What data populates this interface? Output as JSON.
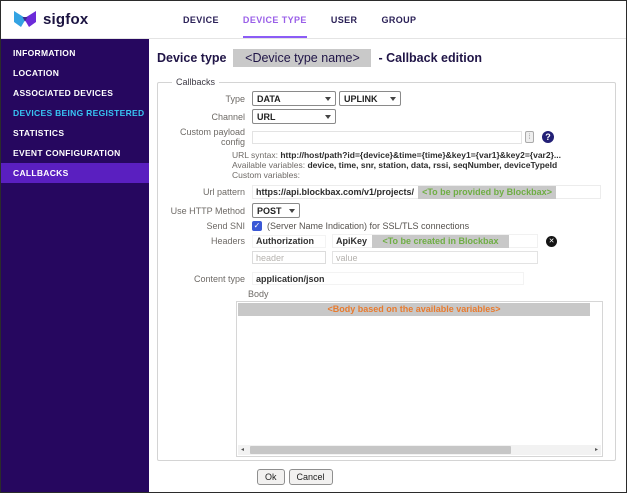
{
  "brand": {
    "logo_text": "sigfox"
  },
  "nav": {
    "items": [
      {
        "label": "DEVICE",
        "active": false
      },
      {
        "label": "DEVICE TYPE",
        "active": true
      },
      {
        "label": "USER",
        "active": false
      },
      {
        "label": "GROUP",
        "active": false
      }
    ]
  },
  "sidebar": {
    "items": [
      {
        "label": "INFORMATION"
      },
      {
        "label": "LOCATION"
      },
      {
        "label": "ASSOCIATED DEVICES"
      },
      {
        "label": "DEVICES BEING REGISTERED",
        "highlighted_cyan": true
      },
      {
        "label": "STATISTICS"
      },
      {
        "label": "EVENT CONFIGURATION"
      },
      {
        "label": "CALLBACKS",
        "active": true
      }
    ]
  },
  "page": {
    "title_prefix": "Device type",
    "device_type_name": "<Device type name>",
    "title_suffix": "- Callback edition"
  },
  "form": {
    "legend": "Callbacks",
    "type_label": "Type",
    "type_value": "DATA",
    "direction_value": "UPLINK",
    "channel_label": "Channel",
    "channel_value": "URL",
    "custom_payload_label": "Custom payload config",
    "custom_payload_value": "",
    "url_syntax_label": "URL syntax:",
    "url_syntax_value": "http://host/path?id={device}&time={time}&key1={var1}&key2={var2}...",
    "available_vars_label": "Available variables:",
    "available_vars_value": "device, time, snr, station, data, rssi, seqNumber, deviceTypeId",
    "custom_vars_label": "Custom variables:",
    "url_pattern_label": "Url pattern",
    "url_pattern_value": "https://api.blockbax.com/v1/projects/",
    "url_pattern_placeholder": "<To be provided by Blockbax>",
    "http_method_label": "Use HTTP Method",
    "http_method_value": "POST",
    "send_sni_label": "Send SNI",
    "send_sni_checked": true,
    "send_sni_note": "(Server Name Indication) for SSL/TLS connections",
    "headers_label": "Headers",
    "headers": {
      "row1": {
        "name": "Authorization",
        "value_prefix": "ApiKey",
        "value_placeholder": "<To be created in Blockbax project>"
      },
      "row2": {
        "name_placeholder": "header",
        "value_placeholder": "value"
      }
    },
    "content_type_label": "Content type",
    "content_type_value": "application/json",
    "body_label": "Body",
    "body_placeholder": "<Body based on the available variables>"
  },
  "actions": {
    "ok": "Ok",
    "cancel": "Cancel"
  },
  "icons": {
    "help_icon": "?",
    "remove_icon": "✕",
    "check_icon": "✓",
    "payload_editor_icon": "⁞",
    "scroll_left": "◂",
    "scroll_right": "▸"
  },
  "colors": {
    "sidebar_bg": "#26075f",
    "sidebar_active_bg": "#5a1fc0",
    "sidebar_cyan_item": "#38c5f3",
    "nav_active_purple": "#9a5fe8",
    "brand_navy": "#1b1340",
    "title_purple": "#201547",
    "placeholder_green": "#6fae44",
    "placeholder_orange": "#e87b2f",
    "chip_gray": "#c8c8c8",
    "checkbox_blue": "#3a58d6",
    "help_icon_navy": "#232076"
  }
}
